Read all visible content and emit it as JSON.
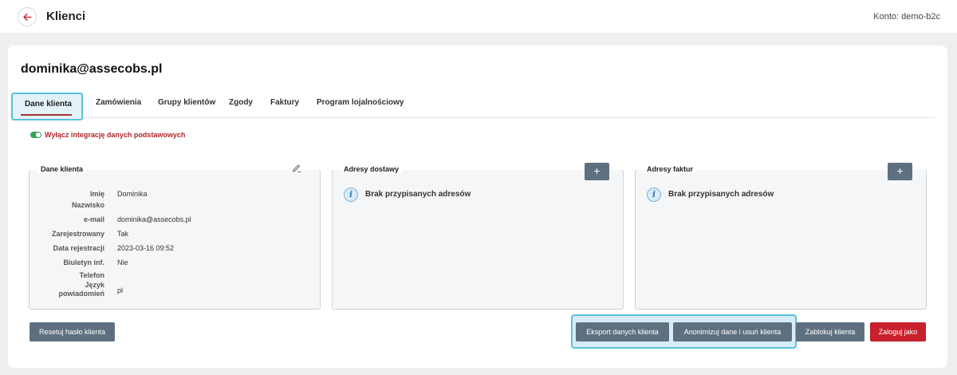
{
  "header": {
    "title": "Klienci",
    "account_label": "Konto:",
    "account_value": "demo-b2c"
  },
  "page": {
    "title": "dominika@assecobs.pl"
  },
  "tabs": [
    {
      "label": "Dane klienta",
      "active": true
    },
    {
      "label": "Zamówienia"
    },
    {
      "label": "Grupy klientów"
    },
    {
      "label": "Zgody"
    },
    {
      "label": "Faktury"
    },
    {
      "label": "Program lojalnościowy"
    }
  ],
  "integration_toggle": {
    "label": "Wyłącz integrację danych podstawowych",
    "on": true
  },
  "client_panel": {
    "title": "Dane klienta",
    "rows": [
      {
        "label": "Imię",
        "value": "Dominika"
      },
      {
        "label": "Nazwisko",
        "value": ""
      },
      {
        "label": "e-mail",
        "value": "dominika@assecobs.pl"
      },
      {
        "label": "Zarejestrowany",
        "value": "Tak"
      },
      {
        "label": "Data rejestracji",
        "value": "2023-03-16 09:52"
      },
      {
        "label": "Biuletyn inf.",
        "value": "Nie"
      },
      {
        "label": "Telefon",
        "value": ""
      },
      {
        "label": "Język",
        "label2": "powiadomień",
        "value": "pl"
      }
    ]
  },
  "delivery_panel": {
    "title": "Adresy dostawy",
    "add_label": "+",
    "empty_text": "Brak przypisanych adresów"
  },
  "invoice_panel": {
    "title": "Adresy faktur",
    "add_label": "+",
    "empty_text": "Brak przypisanych adresów"
  },
  "actions": {
    "reset_password": "Resetuj hasło klienta",
    "export_data": "Eksport danych klienta",
    "anonymize": "Anonimizuj dane i usuń klienta",
    "block": "Zablokuj klienta",
    "login_as": "Zaloguj jako"
  },
  "colors": {
    "accent_red": "#c9202d",
    "button_grey": "#5e7080",
    "highlight_blue": "#5bc0de",
    "toggle_green": "#3aa35b"
  }
}
